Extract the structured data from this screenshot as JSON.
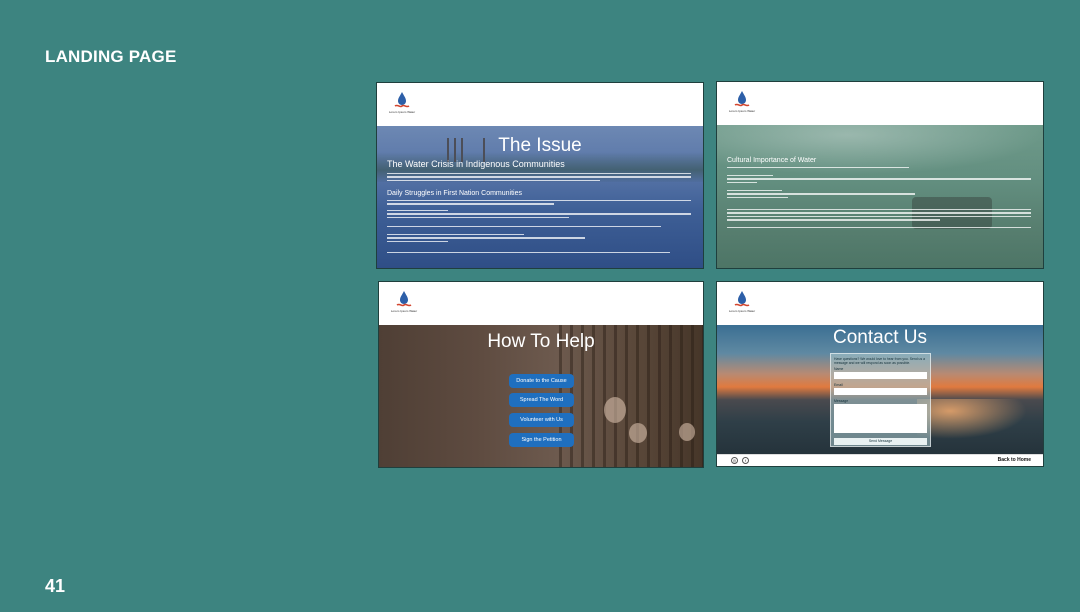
{
  "slide": {
    "title": "LANDING PAGE",
    "page_number": "41"
  },
  "brand": {
    "caption": "Lorem Ipsum Water",
    "primary": "#3d8480",
    "button": "#1f6fbf"
  },
  "issue_page": {
    "title": "The Issue",
    "subtitle": "The Water Crisis in Indigenous Communities",
    "section": "Daily Struggles in First Nation Communities"
  },
  "culture_page": {
    "section": "Cultural Importance of Water"
  },
  "help_page": {
    "title": "How To Help",
    "buttons": [
      "Donate to the Cause",
      "Spread The Word",
      "Volunteer with Us",
      "Sign the Petition"
    ]
  },
  "contact_page": {
    "title": "Contact Us",
    "intro": "Have questions? We would love to hear from you. Send us a message and we will respond as soon as possible.",
    "fields": {
      "name": "Name",
      "email": "Email",
      "message": "Message"
    },
    "submit": "Send Message",
    "footer_link": "Back to Home"
  }
}
